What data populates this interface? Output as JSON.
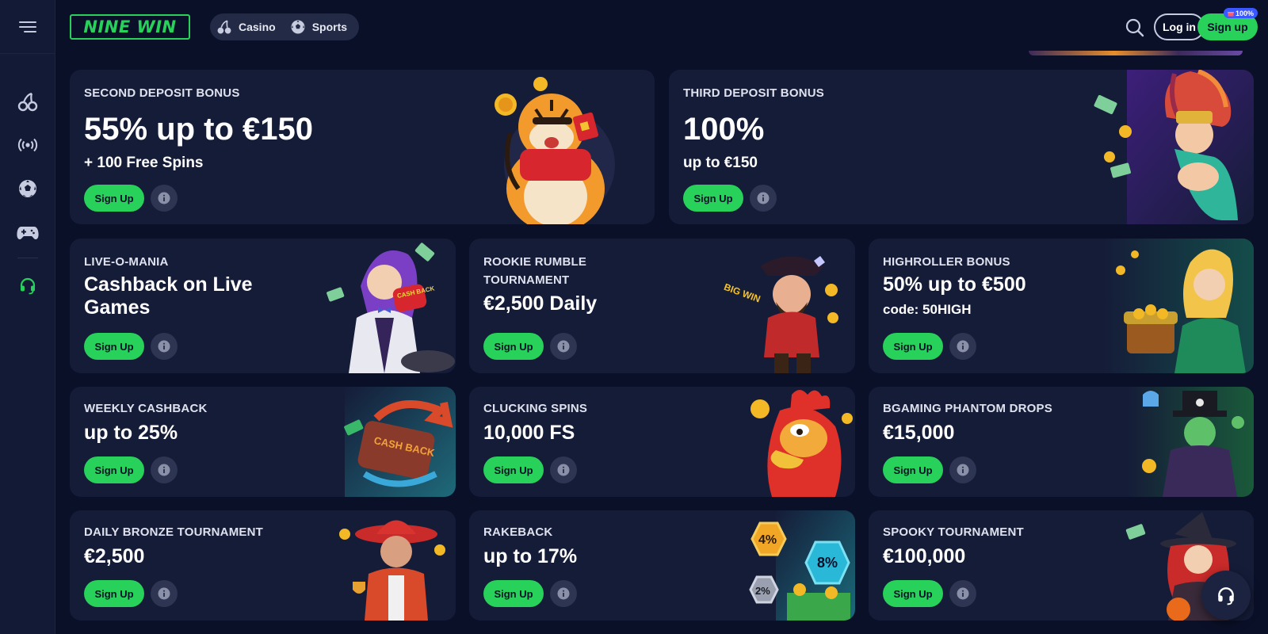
{
  "header": {
    "logo_text": "NINE WIN",
    "tabs": [
      {
        "label": "Casino",
        "icon": "cherry-icon"
      },
      {
        "label": "Sports",
        "icon": "soccer-ball-icon"
      }
    ],
    "login_label": "Log in",
    "signup_label": "Sign up",
    "signup_badge": "100%"
  },
  "sidebar": {
    "items": [
      {
        "icon": "cherry-icon"
      },
      {
        "icon": "live-broadcast-icon"
      },
      {
        "icon": "soccer-ball-icon"
      },
      {
        "icon": "gamepad-icon"
      },
      {
        "icon": "headset-icon"
      }
    ]
  },
  "promos": [
    {
      "eyebrow": "SECOND DEPOSIT BONUS",
      "headline": "55% up to €150",
      "sub": "+ 100 Free Spins",
      "cta": "Sign Up"
    },
    {
      "eyebrow": "THIRD DEPOSIT BONUS",
      "headline": "100%",
      "sub": "up to €150",
      "cta": "Sign Up"
    },
    {
      "eyebrow": "LIVE-O-MANIA",
      "headline": "Cashback on Live Games",
      "cta": "Sign Up"
    },
    {
      "eyebrow": "ROOKIE RUMBLE TOURNAMENT",
      "headline": "€2,500 Daily",
      "cta": "Sign Up"
    },
    {
      "eyebrow": "HIGHROLLER BONUS",
      "headline": "50% up to €500",
      "sub": "code: 50HIGH",
      "cta": "Sign Up"
    },
    {
      "eyebrow": "WEEKLY CASHBACK",
      "headline": "up to 25%",
      "cta": "Sign Up"
    },
    {
      "eyebrow": "CLUCKING SPINS",
      "headline": "10,000 FS",
      "cta": "Sign Up"
    },
    {
      "eyebrow": "BGAMING PHANTOM DROPS",
      "headline": "€15,000",
      "cta": "Sign Up"
    },
    {
      "eyebrow": "DAILY BRONZE TOURNAMENT",
      "headline": "€2,500",
      "cta": "Sign Up"
    },
    {
      "eyebrow": "RAKEBACK",
      "headline": "up to 17%",
      "cta": "Sign Up"
    },
    {
      "eyebrow": "SPOOKY TOURNAMENT",
      "headline": "€100,000",
      "cta": "Sign Up"
    }
  ],
  "art_text": {
    "cashback_badge": "CASH BACK",
    "cashback_box": "CASH BACK",
    "rake_4": "4%",
    "rake_8": "8%",
    "rake_2": "2%",
    "bigwin": "BIG WIN"
  },
  "colors": {
    "accent": "#27d15a",
    "background": "#0b1029",
    "card": "#151c38"
  }
}
